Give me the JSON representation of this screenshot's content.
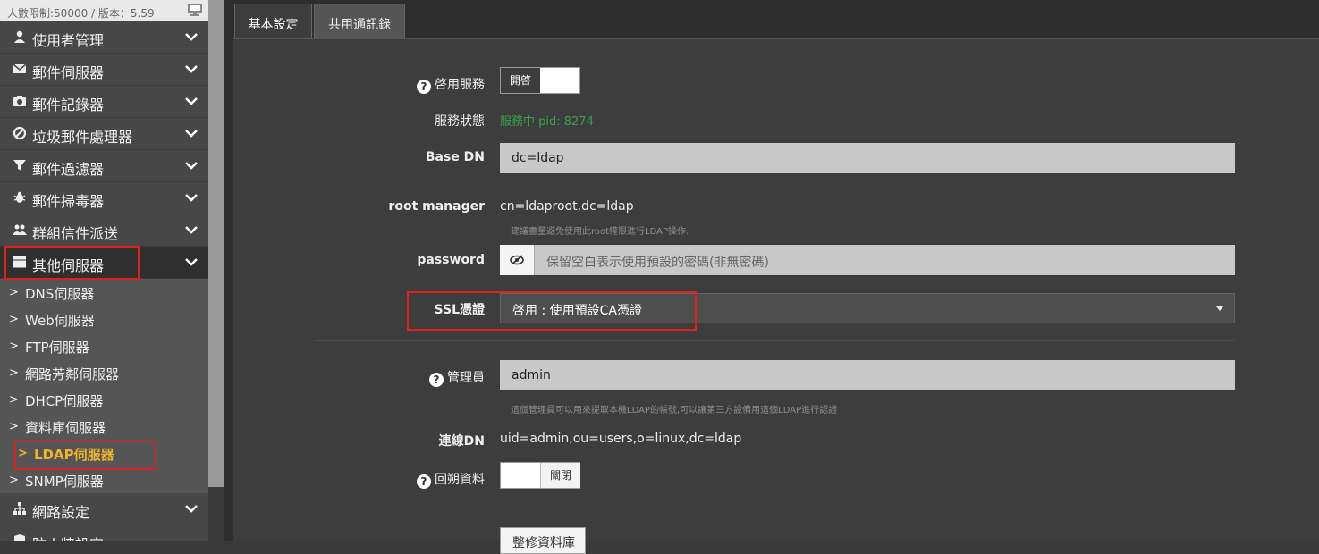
{
  "sidebar": {
    "limit_text": "人數限制:50000 / 版本：5.59",
    "menu": [
      {
        "label": "使用者管理",
        "icon": "user-icon"
      },
      {
        "label": "郵件伺服器",
        "icon": "envelope-icon"
      },
      {
        "label": "郵件記錄器",
        "icon": "camera-icon"
      },
      {
        "label": "垃圾郵件處理器",
        "icon": "ban-icon"
      },
      {
        "label": "郵件過濾器",
        "icon": "filter-icon"
      },
      {
        "label": "郵件掃毒器",
        "icon": "bug-icon"
      },
      {
        "label": "群組信件派送",
        "icon": "users-icon"
      },
      {
        "label": "其他伺服器",
        "icon": "server-icon"
      }
    ],
    "sub_items": [
      {
        "label": "DNS伺服器"
      },
      {
        "label": "Web伺服器"
      },
      {
        "label": "FTP伺服器"
      },
      {
        "label": "網路芳鄰伺服器"
      },
      {
        "label": "DHCP伺服器"
      },
      {
        "label": "資料庫伺服器"
      },
      {
        "label": "LDAP伺服器"
      },
      {
        "label": "SNMP伺服器"
      }
    ],
    "after_menu": [
      {
        "label": "網路設定",
        "icon": "sitemap-icon"
      },
      {
        "label": "防火牆設定",
        "icon": "shield-icon"
      }
    ]
  },
  "tabs": [
    "基本設定",
    "共用通訊錄"
  ],
  "form": {
    "enable_service_label": "啓用服務",
    "enable_service_toggle": "開啓",
    "status_label": "服務狀態",
    "status_value": "服務中 pid: 8274",
    "base_dn_label": "Base DN",
    "base_dn_value": "dc=ldap",
    "root_manager_label": "root manager",
    "root_manager_value": "cn=ldaproot,dc=ldap",
    "root_manager_hint": "建議盡量避免使用此root權限進行LDAP操作.",
    "password_label": "password",
    "password_placeholder": "保留空白表示使用預設的密碼(非無密碼)",
    "ssl_label": "SSL憑證",
    "ssl_value": "啓用 : 使用預設CA憑證",
    "admin_label": "管理員",
    "admin_value": "admin",
    "admin_hint": "這個管理員可以用來提取本機LDAP的帳號,可以讓第三方設備用這個LDAP進行認證",
    "bind_dn_label": "連線DN",
    "bind_dn_value": "uid=admin,ou=users,o=linux,dc=ldap",
    "backtrack_label": "回朔資料",
    "backtrack_toggle": "關閉",
    "repair_button": "整修資料庫"
  },
  "colors": {
    "status_green": "#3aa14b",
    "highlight": "#e01f1f",
    "current_item": "#f0b429"
  }
}
